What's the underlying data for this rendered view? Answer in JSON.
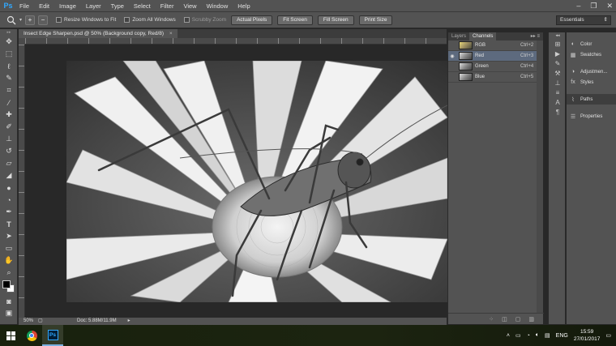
{
  "menubar": {
    "logo": "Ps",
    "items": [
      "File",
      "Edit",
      "Image",
      "Layer",
      "Type",
      "Select",
      "Filter",
      "View",
      "Window",
      "Help"
    ],
    "window_controls": [
      "–",
      "❐",
      "✕"
    ]
  },
  "options": {
    "zoom_in": "+",
    "zoom_out": "−",
    "resize_windows_label": "Resize Windows to Fit",
    "zoom_all_label": "Zoom All Windows",
    "scrubby_zoom_label": "Scrubby Zoom",
    "actual_pixels": "Actual Pixels",
    "fit_screen": "Fit Screen",
    "fill_screen": "Fill Screen",
    "print_size": "Print Size",
    "workspace": "Essentials"
  },
  "document": {
    "tab_title": "Insect Edge Sharpen.psd @ 50% (Background copy, Red/8)",
    "close": "×"
  },
  "status": {
    "zoom": "50%",
    "doc_size": "Doc: 5.88M/11.9M"
  },
  "channels_panel": {
    "tabs": [
      "Layers",
      "Channels"
    ],
    "menu": "▸▸ ≡",
    "channels": [
      {
        "name": "RGB",
        "shortcut": "Ctrl+2",
        "selected": false
      },
      {
        "name": "Red",
        "shortcut": "Ctrl+3",
        "selected": true
      },
      {
        "name": "Green",
        "shortcut": "Ctrl+4",
        "selected": false
      },
      {
        "name": "Blue",
        "shortcut": "Ctrl+5",
        "selected": false
      }
    ]
  },
  "right_panels": {
    "items": [
      "Color",
      "Swatches",
      "Adjustmen...",
      "Styles",
      "Paths",
      "Properties"
    ]
  },
  "taskbar": {
    "ps_label": "Ps",
    "language": "ENG",
    "time": "15:59",
    "date": "27/01/2017"
  }
}
